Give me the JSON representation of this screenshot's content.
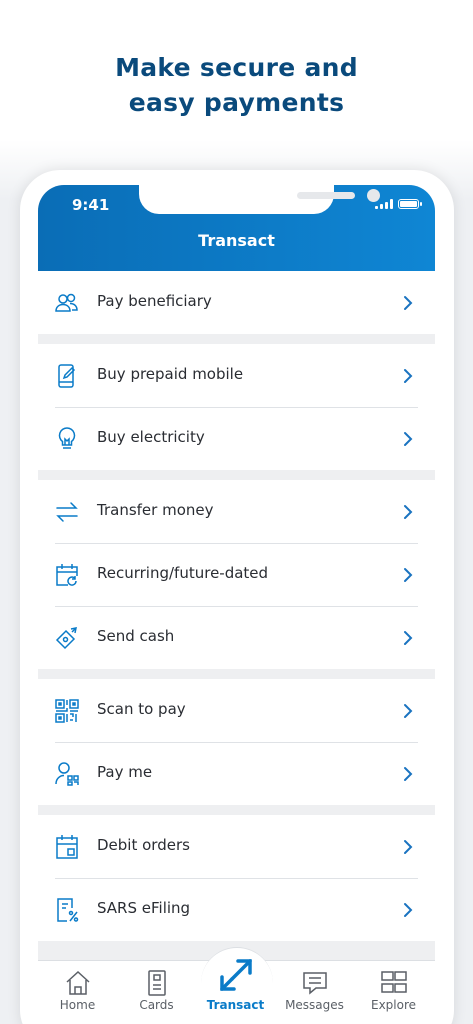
{
  "promo": {
    "headline_line1": "Make secure and",
    "headline_line2": "easy payments"
  },
  "status_bar": {
    "time": "9:41"
  },
  "app": {
    "title": "Transact"
  },
  "menu_groups": [
    {
      "items": [
        {
          "label": "Pay beneficiary",
          "icon": "people-icon"
        }
      ]
    },
    {
      "items": [
        {
          "label": "Buy prepaid mobile",
          "icon": "mobile-edit-icon"
        },
        {
          "label": "Buy electricity",
          "icon": "lightbulb-icon"
        }
      ]
    },
    {
      "items": [
        {
          "label": "Transfer money",
          "icon": "transfer-arrows-icon"
        },
        {
          "label": "Recurring/future-dated",
          "icon": "calendar-recurring-icon"
        },
        {
          "label": "Send cash",
          "icon": "send-cash-icon"
        }
      ]
    },
    {
      "items": [
        {
          "label": "Scan to pay",
          "icon": "qr-code-icon"
        },
        {
          "label": "Pay me",
          "icon": "person-qr-icon"
        }
      ]
    },
    {
      "items": [
        {
          "label": "Debit orders",
          "icon": "calendar-debit-icon"
        },
        {
          "label": "SARS eFiling",
          "icon": "document-percent-icon"
        }
      ]
    }
  ],
  "tabbar": {
    "tabs": [
      {
        "label": "Home",
        "icon": "home-icon"
      },
      {
        "label": "Cards",
        "icon": "card-icon"
      },
      {
        "label": "Transact",
        "icon": "transact-icon"
      },
      {
        "label": "Messages",
        "icon": "messages-icon"
      },
      {
        "label": "Explore",
        "icon": "explore-grid-icon"
      }
    ],
    "active": "Transact"
  },
  "colors": {
    "headline": "#0a4a7c",
    "header_gradient_start": "#0a6db6",
    "header_gradient_end": "#0f86d4",
    "icon_blue": "#0a7bc8",
    "chevron_blue": "#1a73c0"
  }
}
